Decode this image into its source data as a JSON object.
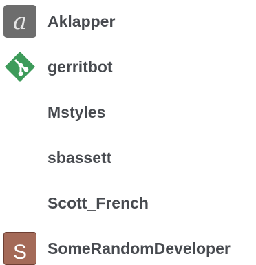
{
  "users": [
    {
      "name": "Aklapper",
      "avatar_letter": "a",
      "avatar_icon": "letter-a-avatar",
      "avatar_color": "#6d6d6d"
    },
    {
      "name": "gerritbot",
      "avatar_icon": "git-diamond-icon",
      "avatar_color": "#3d9b5a"
    },
    {
      "name": "Mstyles"
    },
    {
      "name": "sbassett"
    },
    {
      "name": "Scott_French"
    },
    {
      "name": "SomeRandomDeveloper",
      "avatar_letter": "S",
      "avatar_icon": "letter-s-avatar",
      "avatar_color": "#a46a58"
    }
  ],
  "colors": {
    "text": "#474a4f",
    "background": "#ffffff"
  }
}
